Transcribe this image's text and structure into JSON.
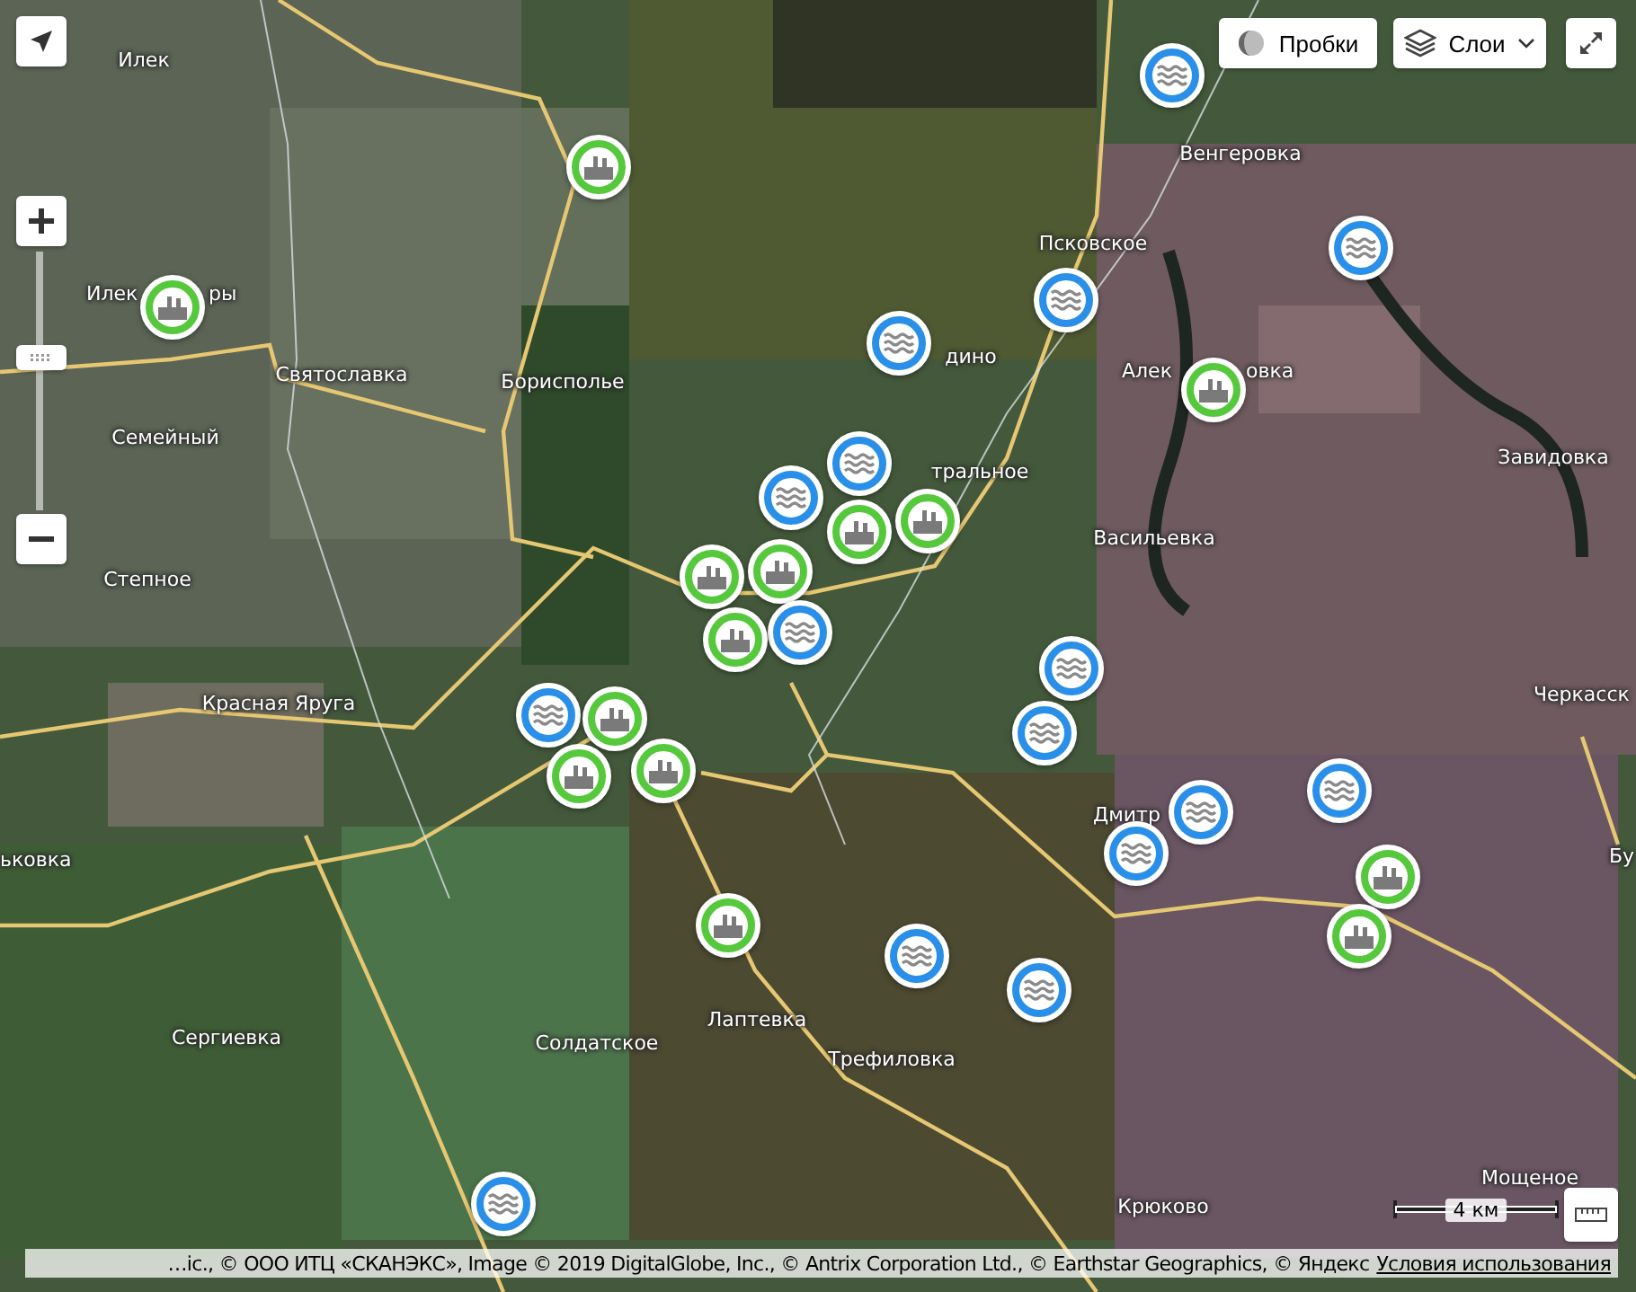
{
  "toolbar": {
    "traffic_button": {
      "label": "Пробки"
    },
    "layers_button": {
      "label": "Слои"
    }
  },
  "zoom_control": {
    "level": 0.59
  },
  "places": [
    {
      "name": "Илек"
    },
    {
      "name": "Венгеровка"
    },
    {
      "name": "Псковское"
    },
    {
      "name": "Илек"
    },
    {
      "name": "ры"
    },
    {
      "name": "дино"
    },
    {
      "name": "Святославка"
    },
    {
      "name": "Борисполье"
    },
    {
      "name": "Алек"
    },
    {
      "name": "овка"
    },
    {
      "name": "Семейный"
    },
    {
      "name": "Завидовка"
    },
    {
      "name": "тральное"
    },
    {
      "name": "Васильевка"
    },
    {
      "name": "Степное"
    },
    {
      "name": "Черкасск"
    },
    {
      "name": "Красная Яруга"
    },
    {
      "name": "Дмитр"
    },
    {
      "name": "Бу"
    },
    {
      "name": "ьковка"
    },
    {
      "name": "Лаптевка"
    },
    {
      "name": "Сергиевка"
    },
    {
      "name": "Солдатское"
    },
    {
      "name": "Трефиловка"
    },
    {
      "name": "Мощеное"
    },
    {
      "name": "Крюково"
    }
  ],
  "markers": [
    {
      "kind": "water"
    },
    {
      "kind": "factory"
    },
    {
      "kind": "water"
    },
    {
      "kind": "water"
    },
    {
      "kind": "factory"
    },
    {
      "kind": "water"
    },
    {
      "kind": "factory"
    },
    {
      "kind": "water"
    },
    {
      "kind": "water"
    },
    {
      "kind": "factory"
    },
    {
      "kind": "factory"
    },
    {
      "kind": "factory"
    },
    {
      "kind": "factory"
    },
    {
      "kind": "water"
    },
    {
      "kind": "factory"
    },
    {
      "kind": "water"
    },
    {
      "kind": "water"
    },
    {
      "kind": "factory"
    },
    {
      "kind": "water"
    },
    {
      "kind": "factory"
    },
    {
      "kind": "factory"
    },
    {
      "kind": "water"
    },
    {
      "kind": "water"
    },
    {
      "kind": "water"
    },
    {
      "kind": "factory"
    },
    {
      "kind": "factory"
    },
    {
      "kind": "factory"
    },
    {
      "kind": "water"
    },
    {
      "kind": "water"
    },
    {
      "kind": "water"
    }
  ],
  "scale": {
    "label": "4 км"
  },
  "attribution": {
    "text": "…ic., © ООО ИТЦ «СКАНЭКС», Image © 2019 DigitalGlobe, Inc., © Antrix Corporation Ltd., © Earthstar Geographics, © Яндекс",
    "link": "Условия использования"
  }
}
